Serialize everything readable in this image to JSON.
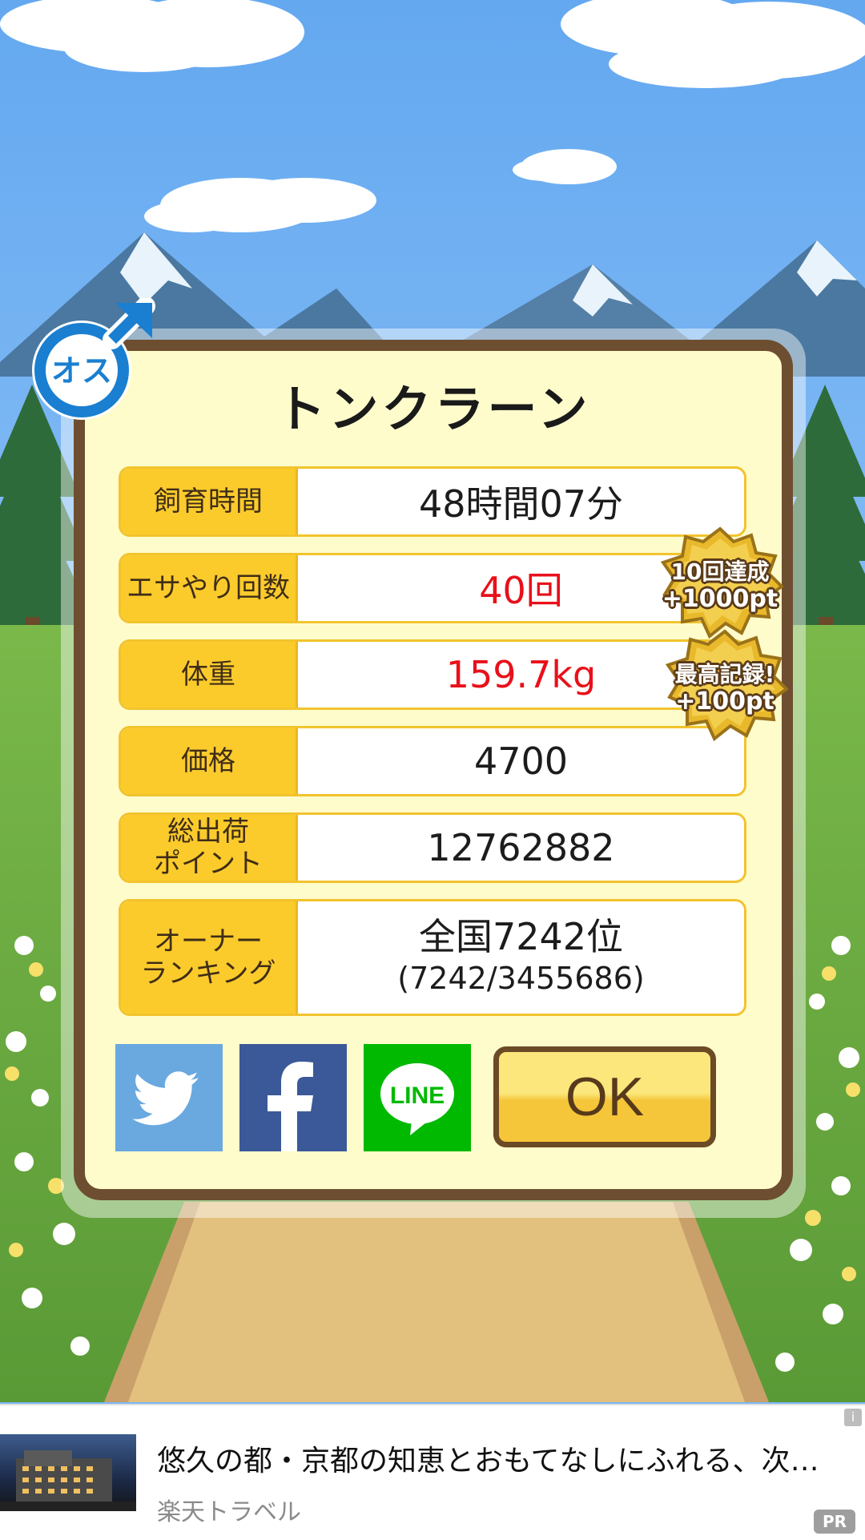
{
  "colors": {
    "sky": "#7ab6f2",
    "panel_bg": "#fffccc",
    "panel_border": "#6e4e30",
    "label_bg": "#fbcb2c",
    "highlight_red": "#e8101a",
    "twitter": "#6aa8e0",
    "facebook": "#3b5998",
    "line": "#00b900",
    "ok": "#f5c53a"
  },
  "gender_badge": {
    "text": "オス",
    "icon": "male-symbol-icon"
  },
  "pig_name": "トンクラーン",
  "stats": [
    {
      "label": "飼育時間",
      "value": "48時間07分",
      "highlight": false
    },
    {
      "label": "エサやり回数",
      "value": "40回",
      "highlight": true
    },
    {
      "label": "体重",
      "value": "159.7kg",
      "highlight": true
    },
    {
      "label": "価格",
      "value": "4700",
      "highlight": false
    },
    {
      "label": "総出荷\nポイント",
      "value": "12762882",
      "highlight": false
    }
  ],
  "ranking": {
    "label": "オーナー\nランキング",
    "rank": "全国7242位",
    "detail": "(7242/3455686)"
  },
  "medals": [
    {
      "line1": "10回達成",
      "line2": "+1000pt"
    },
    {
      "line1": "最高記録!",
      "line2": "+100pt"
    }
  ],
  "share": {
    "twitter_icon": "twitter-bird-icon",
    "facebook_icon": "facebook-f-icon",
    "line_label": "LINE"
  },
  "ok_label": "OK",
  "ad": {
    "title": "悠久の都・京都の知恵とおもてなしにふれる、次の…",
    "advertiser": "楽天トラベル",
    "pr_label": "PR",
    "info_label": "i"
  }
}
